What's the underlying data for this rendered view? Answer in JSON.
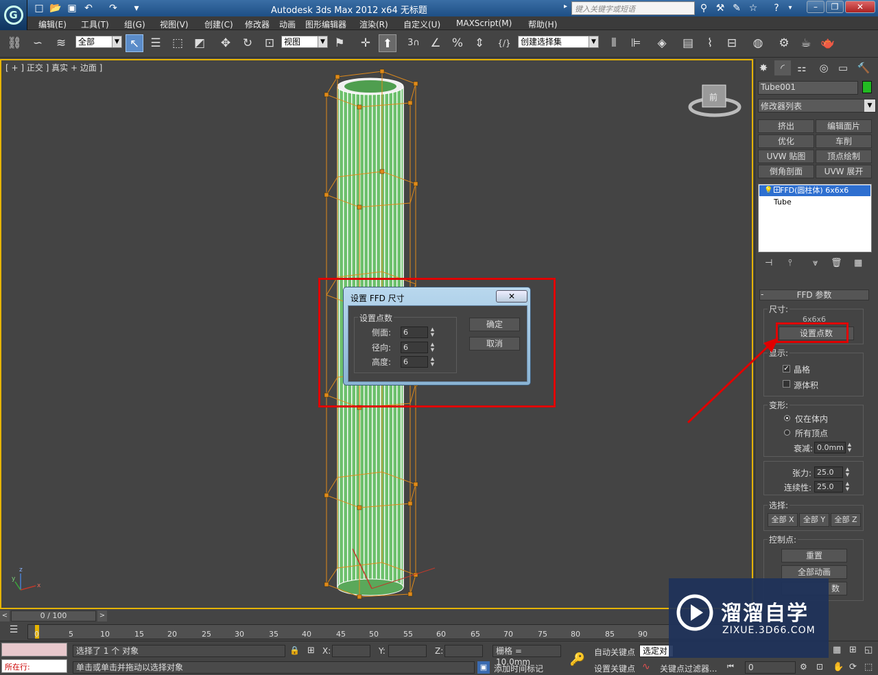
{
  "titlebar": {
    "title": "Autodesk 3ds Max  2012 x64     无标题",
    "search_placeholder": "键入关键字或短语"
  },
  "menubar": {
    "items": [
      "编辑(E)",
      "工具(T)",
      "组(G)",
      "视图(V)",
      "创建(C)",
      "修改器",
      "动画",
      "图形编辑器",
      "渲染(R)",
      "自定义(U)",
      "MAXScript(M)",
      "帮助(H)"
    ]
  },
  "toolbar": {
    "selection_filter": "全部",
    "ref_coord": "视图",
    "named_selection": "创建选择集",
    "snap_label": "3"
  },
  "viewport": {
    "label": "[ + ] 正交 ] 真实 + 边面 ]",
    "viewcube_label": "前",
    "axis_x": "x",
    "axis_y": "y",
    "axis_z": "z"
  },
  "dialog": {
    "title": "设置 FFD 尺寸",
    "group_title": "设置点数",
    "fields": [
      {
        "label": "侧面:",
        "value": "6"
      },
      {
        "label": "径向:",
        "value": "6"
      },
      {
        "label": "高度:",
        "value": "6"
      }
    ],
    "ok": "确定",
    "cancel": "取消"
  },
  "command_panel": {
    "object_name": "Tube001",
    "object_color": "#22bb22",
    "modifier_list": "修改器列表",
    "modifier_buttons": [
      "挤出",
      "编辑面片",
      "优化",
      "车削",
      "UVW 贴图",
      "顶点绘制",
      "倒角剖面",
      "UVW 展开"
    ],
    "stack": [
      {
        "label": "FFD(圆柱体) 6x6x6",
        "selected": true
      },
      {
        "label": "Tube",
        "selected": false
      }
    ],
    "rollout_title": "FFD 参数",
    "size_group": "尺寸:",
    "size_value": "6x6x6",
    "set_points_button": "设置点数",
    "display_group": "显示:",
    "lattice_label": "晶格",
    "lattice_checked": true,
    "source_volume_label": "源体积",
    "source_volume_checked": false,
    "deform_group": "变形:",
    "only_in_volume": "仅在体内",
    "all_vertices": "所有顶点",
    "falloff_label": "衰减:",
    "falloff_value": "0.0mm",
    "tension_label": "张力:",
    "tension_value": "25.0",
    "continuity_label": "连续性:",
    "continuity_value": "25.0",
    "select_group": "选择:",
    "select_buttons": [
      "全部 X",
      "全部 Y",
      "全部 Z"
    ],
    "control_points_group": "控制点:",
    "reset_button": "重置",
    "animate_all_button": "全部动画",
    "conform_partial": "数"
  },
  "timeline": {
    "frame_display": "0 / 100",
    "ticks": [
      "0",
      "5",
      "10",
      "15",
      "20",
      "25",
      "30",
      "35",
      "40",
      "45",
      "50",
      "55",
      "60",
      "65",
      "70",
      "75",
      "80",
      "85",
      "90"
    ]
  },
  "status": {
    "selected_text": "选择了 1 个 对象",
    "prompt_text": "单击或单击并拖动以选择对象",
    "x_label": "X:",
    "y_label": "Y:",
    "z_label": "Z:",
    "grid_text": "栅格 = 10.0mm",
    "add_time_tag": "添加时间标记",
    "auto_key": "自动关键点",
    "set_key": "设置关键点",
    "selected_dropdown": "选定对",
    "key_filter": "关键点过滤器...",
    "frame_field": "0",
    "script_label": "所在行:"
  },
  "watermark": {
    "brand": "溜溜自学",
    "url": "ZIXUE.3D66.COM"
  }
}
